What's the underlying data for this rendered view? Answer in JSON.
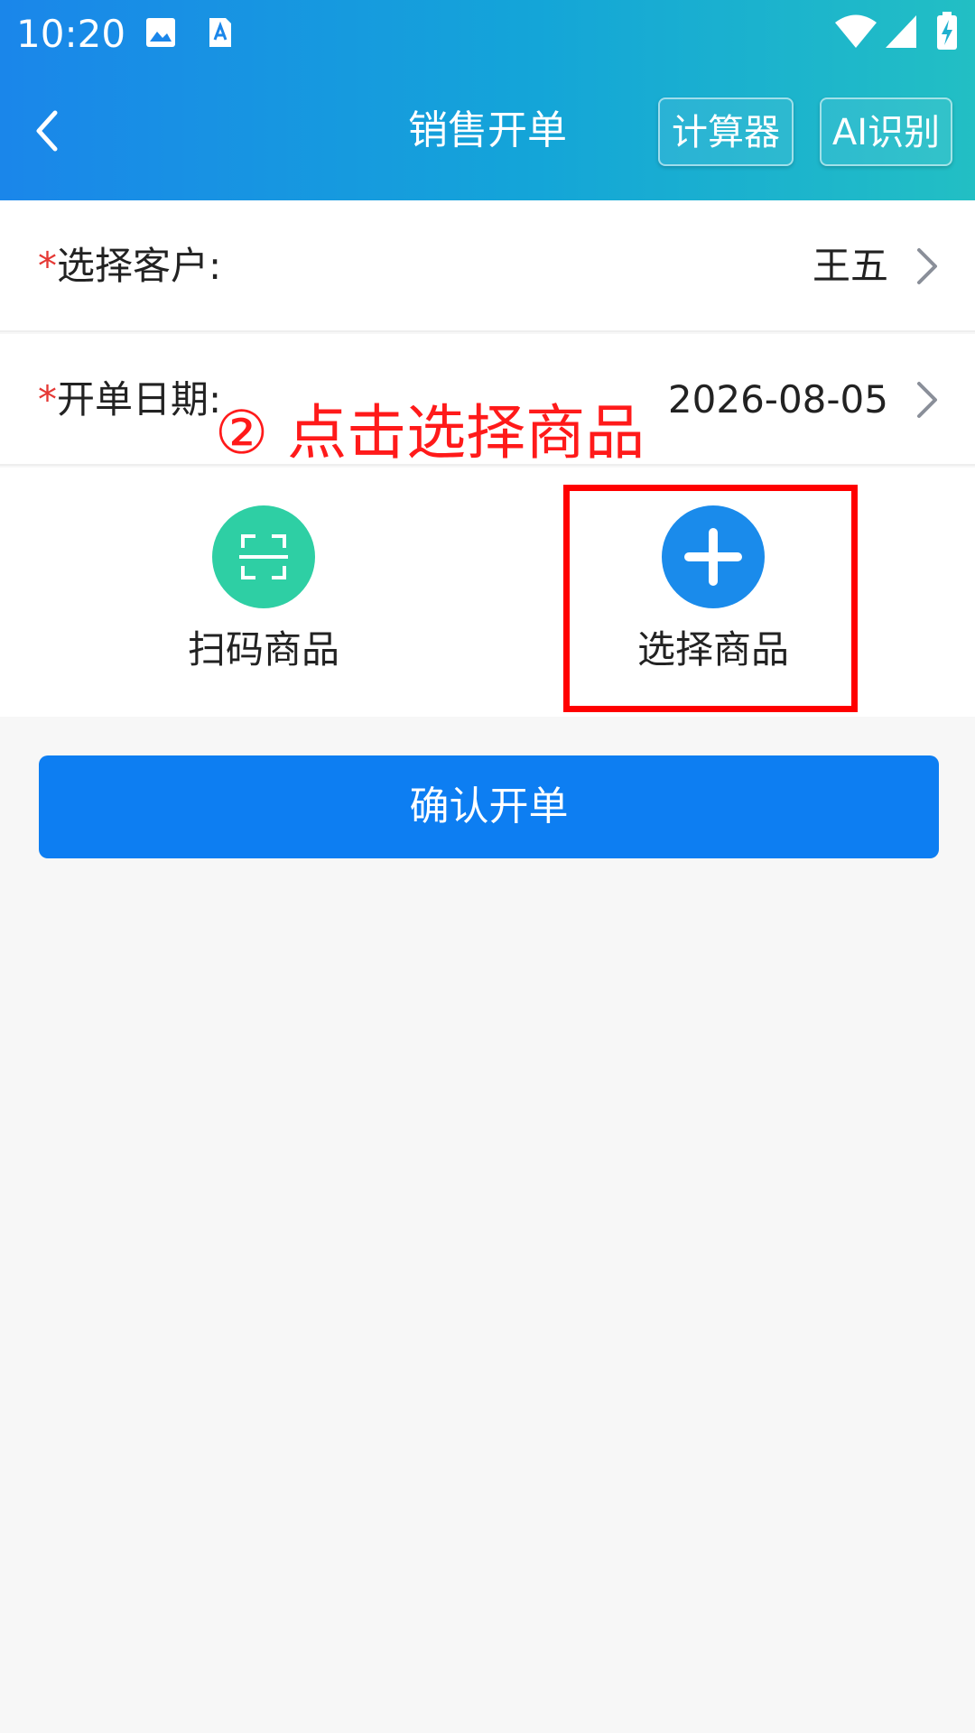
{
  "status_bar": {
    "time": "10:20",
    "icons": [
      "image-icon",
      "text-recognition-icon",
      "wifi-icon",
      "cell-signal-icon",
      "battery-charging-icon"
    ]
  },
  "header": {
    "title": "销售开单",
    "back_icon": "chevron-left-icon",
    "calculator_label": "计算器",
    "ai_label": "AI识别"
  },
  "form": {
    "customer": {
      "required_mark": "*",
      "label": "选择客户:",
      "value": "王五"
    },
    "date": {
      "required_mark": "*",
      "label": "开单日期:",
      "value": "2026-08-05"
    }
  },
  "actions": {
    "scan": {
      "label": "扫码商品",
      "icon": "scan-icon",
      "color": "#2ecfa4"
    },
    "select": {
      "label": "选择商品",
      "icon": "plus-icon",
      "color": "#1a8beb"
    }
  },
  "annotation": {
    "text": "② 点击选择商品",
    "color": "#ff0000"
  },
  "confirm_button": {
    "label": "确认开单",
    "color": "#0d7ef2"
  }
}
